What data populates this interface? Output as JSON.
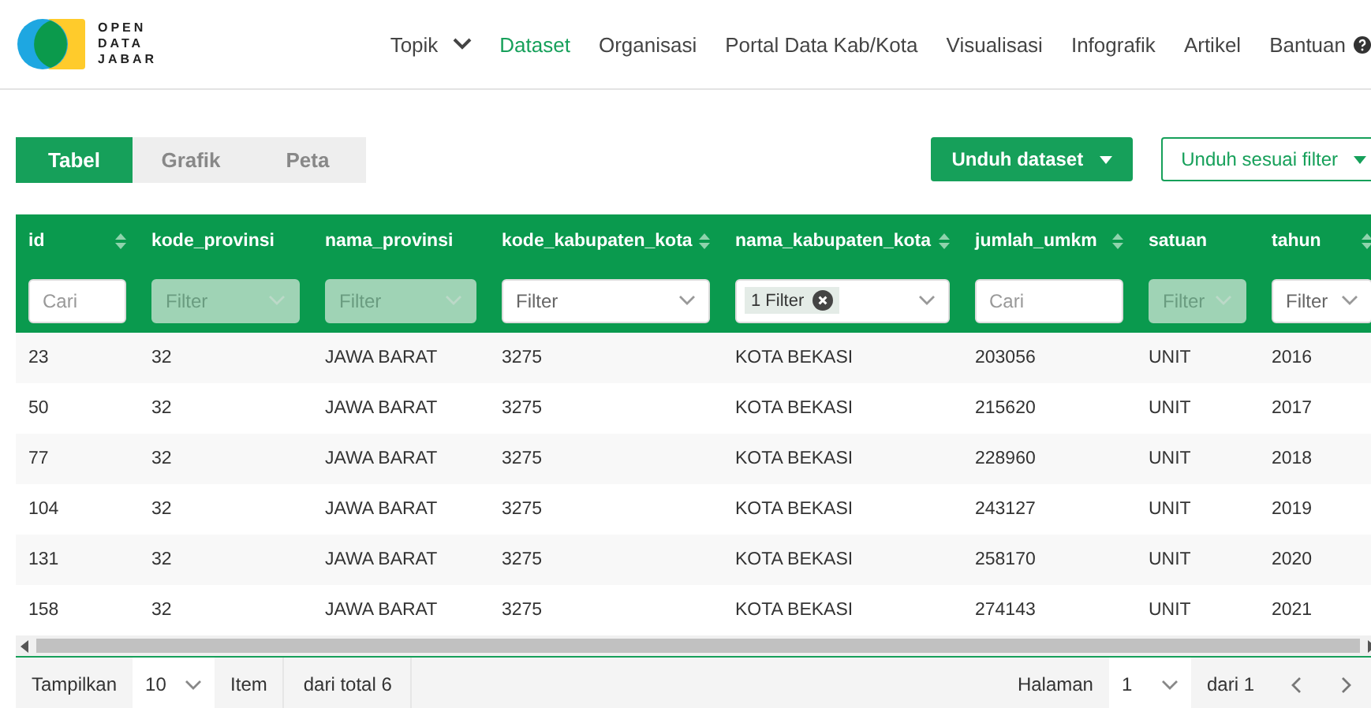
{
  "logo": {
    "lines": [
      "OPEN",
      "DATA",
      "JABAR"
    ]
  },
  "nav": [
    {
      "label": "Topik",
      "selected": false,
      "dropdown": true
    },
    {
      "label": "Dataset",
      "selected": true,
      "dropdown": false
    },
    {
      "label": "Organisasi",
      "selected": false,
      "dropdown": false
    },
    {
      "label": "Portal Data Kab/Kota",
      "selected": false,
      "dropdown": false
    },
    {
      "label": "Visualisasi",
      "selected": false,
      "dropdown": false
    },
    {
      "label": "Infografik",
      "selected": false,
      "dropdown": false
    },
    {
      "label": "Artikel",
      "selected": false,
      "dropdown": false
    },
    {
      "label": "Bantuan",
      "selected": false,
      "dropdown": false,
      "help": true
    }
  ],
  "tabs": [
    {
      "label": "Tabel",
      "selected": true
    },
    {
      "label": "Grafik",
      "selected": false
    },
    {
      "label": "Peta",
      "selected": false
    }
  ],
  "buttons": [
    {
      "label": "Unduh dataset",
      "kind": "primary"
    },
    {
      "label": "Unduh sesuai filter",
      "kind": "outline"
    }
  ],
  "table": {
    "columns": [
      {
        "label": "id",
        "sortable": true,
        "filter": {
          "kind": "search",
          "placeholder": "Cari"
        }
      },
      {
        "label": "kode_provinsi",
        "sortable": false,
        "filter": {
          "kind": "select",
          "placeholder": "Filter",
          "disabled": true
        }
      },
      {
        "label": "nama_provinsi",
        "sortable": false,
        "filter": {
          "kind": "select",
          "placeholder": "Filter",
          "disabled": true
        }
      },
      {
        "label": "kode_kabupaten_kota",
        "sortable": true,
        "filter": {
          "kind": "select",
          "placeholder": "Filter",
          "disabled": false
        }
      },
      {
        "label": "nama_kabupaten_kota",
        "sortable": true,
        "filter": {
          "kind": "chip",
          "chip": "1 Filter"
        }
      },
      {
        "label": "jumlah_umkm",
        "sortable": true,
        "filter": {
          "kind": "search",
          "placeholder": "Cari"
        }
      },
      {
        "label": "satuan",
        "sortable": false,
        "filter": {
          "kind": "select",
          "placeholder": "Filter",
          "disabled": true
        }
      },
      {
        "label": "tahun",
        "sortable": true,
        "filter": {
          "kind": "select",
          "placeholder": "Filter",
          "disabled": false
        }
      }
    ],
    "rows": [
      [
        "23",
        "32",
        "JAWA BARAT",
        "3275",
        "KOTA BEKASI",
        "203056",
        "UNIT",
        "2016"
      ],
      [
        "50",
        "32",
        "JAWA BARAT",
        "3275",
        "KOTA BEKASI",
        "215620",
        "UNIT",
        "2017"
      ],
      [
        "77",
        "32",
        "JAWA BARAT",
        "3275",
        "KOTA BEKASI",
        "228960",
        "UNIT",
        "2018"
      ],
      [
        "104",
        "32",
        "JAWA BARAT",
        "3275",
        "KOTA BEKASI",
        "243127",
        "UNIT",
        "2019"
      ],
      [
        "131",
        "32",
        "JAWA BARAT",
        "3275",
        "KOTA BEKASI",
        "258170",
        "UNIT",
        "2020"
      ],
      [
        "158",
        "32",
        "JAWA BARAT",
        "3275",
        "KOTA BEKASI",
        "274143",
        "UNIT",
        "2021"
      ]
    ]
  },
  "footer": {
    "show_label": "Tampilkan",
    "page_size": "10",
    "item_label": "Item",
    "total": "dari total 6",
    "page_label": "Halaman",
    "page": "1",
    "of_pages": "dari 1"
  }
}
